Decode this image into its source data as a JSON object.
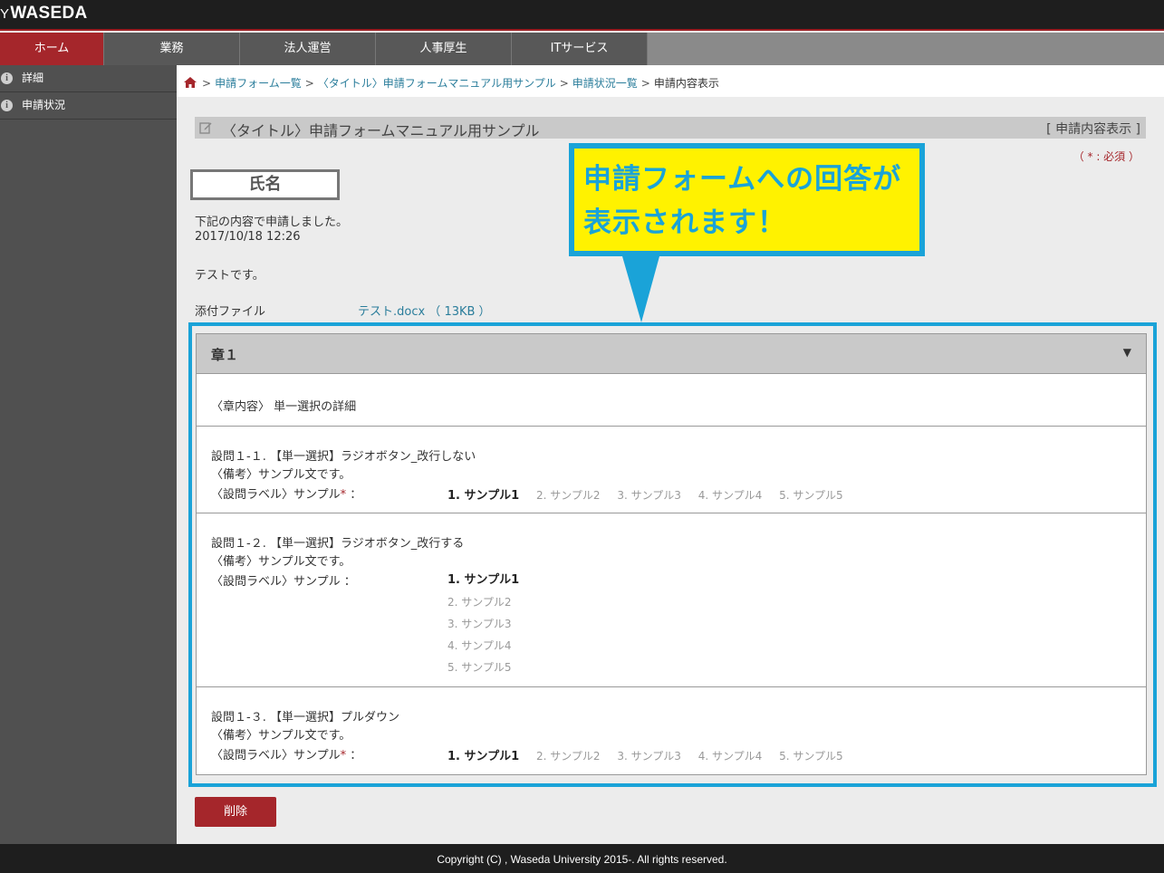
{
  "brand": {
    "prefix": "Y",
    "name": "WASEDA"
  },
  "nav": {
    "items": [
      {
        "label": "ホーム"
      },
      {
        "label": "業務"
      },
      {
        "label": "法人運営"
      },
      {
        "label": "人事厚生"
      },
      {
        "label": "ITサービス"
      }
    ],
    "active_index": 0
  },
  "sidebar": {
    "items": [
      {
        "label": "詳細",
        "icon": "info-icon"
      },
      {
        "label": "申請状況",
        "icon": "info-icon"
      }
    ]
  },
  "breadcrumb": {
    "items": [
      "申請フォーム一覧",
      "〈タイトル〉申請フォームマニュアル用サンプル",
      "申請状況一覧"
    ],
    "current": "申請内容表示",
    "separator": ">"
  },
  "page": {
    "title": "〈タイトル〉申請フォームマニュアル用サンプル",
    "mode": "[ 申請内容表示 ]",
    "required_note": "（ * : 必須 ）"
  },
  "submission": {
    "name_label": "氏名",
    "message": "下記の内容で申請しました。",
    "date": "2017/10/18 12:26",
    "body": "テストです。",
    "attachment_label": "添付ファイル",
    "attachment": "テスト.docx （ 13KB ）"
  },
  "callout": {
    "line1": "申請フォームへの回答が",
    "line2": "表示されます！"
  },
  "chapter": {
    "title": "章１",
    "toggle": "▼",
    "content": "〈章内容〉 単一選択の詳細",
    "questions": [
      {
        "title": "設問１-１. 【単一選択】ラジオボタン_改行しない",
        "note": "〈備考〉サンプル文です。",
        "label": "〈設問ラベル〉サンプル",
        "required_mark": "*",
        "colon": "：",
        "options": [
          "1. サンプル1",
          "2. サンプル2",
          "3. サンプル3",
          "4. サンプル4",
          "5. サンプル5"
        ],
        "selected": 0
      },
      {
        "title": "設問１-２. 【単一選択】ラジオボタン_改行する",
        "note": "〈備考〉サンプル文です。",
        "label": "〈設問ラベル〉サンプル",
        "required_mark": "",
        "colon": "：",
        "options": [
          "1. サンプル1",
          "2. サンプル2",
          "3. サンプル3",
          "4. サンプル4",
          "5. サンプル5"
        ],
        "selected": 0
      },
      {
        "title": "設問１-３. 【単一選択】プルダウン",
        "note": "〈備考〉サンプル文です。",
        "label": "〈設問ラベル〉サンプル",
        "required_mark": "*",
        "colon": "：",
        "options": [
          "1. サンプル1",
          "2. サンプル2",
          "3. サンプル3",
          "4. サンプル4",
          "5. サンプル5"
        ],
        "selected": 0
      }
    ]
  },
  "actions": {
    "delete_label": "削除"
  },
  "footer": {
    "copyright": "Copyright (C) , Waseda University 2015-. All rights reserved."
  },
  "colors": {
    "brand_red": "#a5262b",
    "accent_blue": "#1aa3d8",
    "callout_yellow": "#fff200",
    "link": "#2a7d9b"
  }
}
